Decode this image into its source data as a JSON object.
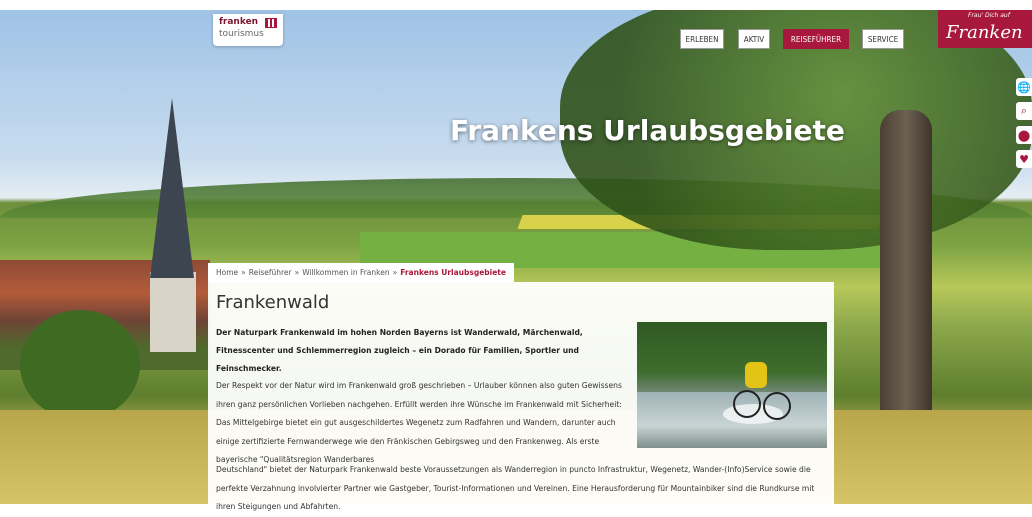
{
  "logo": {
    "top": "franken",
    "bottom": "tourismus"
  },
  "nav": [
    {
      "label": "ERLEBEN"
    },
    {
      "label": "AKTIV"
    },
    {
      "label": "REISEFÜHRER"
    },
    {
      "label": "SERVICE"
    }
  ],
  "brand": {
    "small": "Frau' Dich auf",
    "big": "Franken"
  },
  "side": {
    "globe": "🌐",
    "search": "⌕",
    "pin": "⬤",
    "heart": "♥"
  },
  "hero": {
    "title": "Frankens Urlaubsgebiete"
  },
  "breadcrumb": {
    "items": [
      "Home",
      "Reiseführer",
      "Willkommen in Franken"
    ],
    "separator": "»",
    "current": "Frankens Urlaubsgebiete"
  },
  "article": {
    "title": "Frankenwald",
    "intro": "Der Naturpark Frankenwald im hohen Norden Bayerns ist Wanderwald, Märchenwald, Fitnesscenter und Schlemmerregion zugleich – ein Dorado für Familien, Sportler und Feinschmecker.",
    "body1": "Der Respekt vor der Natur wird im Frankenwald groß geschrieben – Urlauber können also guten Gewissens ihren ganz persönlichen Vorlieben nachgehen. Erfüllt werden ihre Wünsche im Frankenwald mit Sicherheit: Das Mittelgebirge bietet ein gut ausgeschildertes Wegenetz zum Radfahren und Wandern, darunter auch einige zertifizierte Fernwanderwege wie den Fränkischen Gebirgsweg und den Frankenweg. Als erste bayerische \"Qualitätsregion Wanderbares",
    "body2": "Deutschland\" bietet der Naturpark Frankenwald beste Voraussetzungen als Wanderregion in puncto Infrastruktur, Wegenetz, Wander-(Info)Service sowie die perfekte Verzahnung involvierter Partner wie Gastgeber, Tourist-Informationen und Vereinen. Eine Herausforderung für Mountainbiker sind die Rundkurse mit ihren Steigungen und Abfahrten."
  },
  "colors": {
    "accent": "#a8183c"
  }
}
